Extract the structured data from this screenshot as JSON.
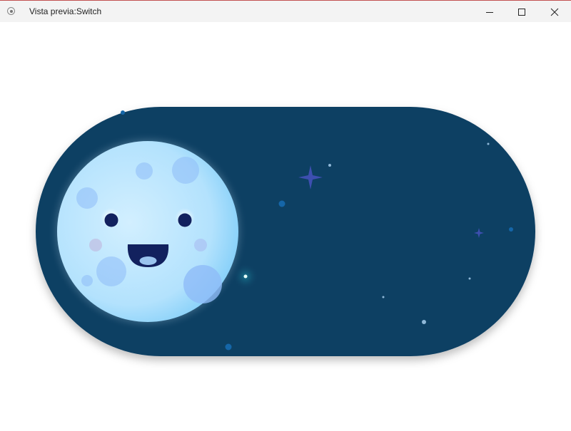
{
  "window": {
    "title": "Vista previa:Switch"
  },
  "switch": {
    "state": "off",
    "theme": "night",
    "track_color": "#113f63",
    "moon_color": "#b8e4ff"
  }
}
